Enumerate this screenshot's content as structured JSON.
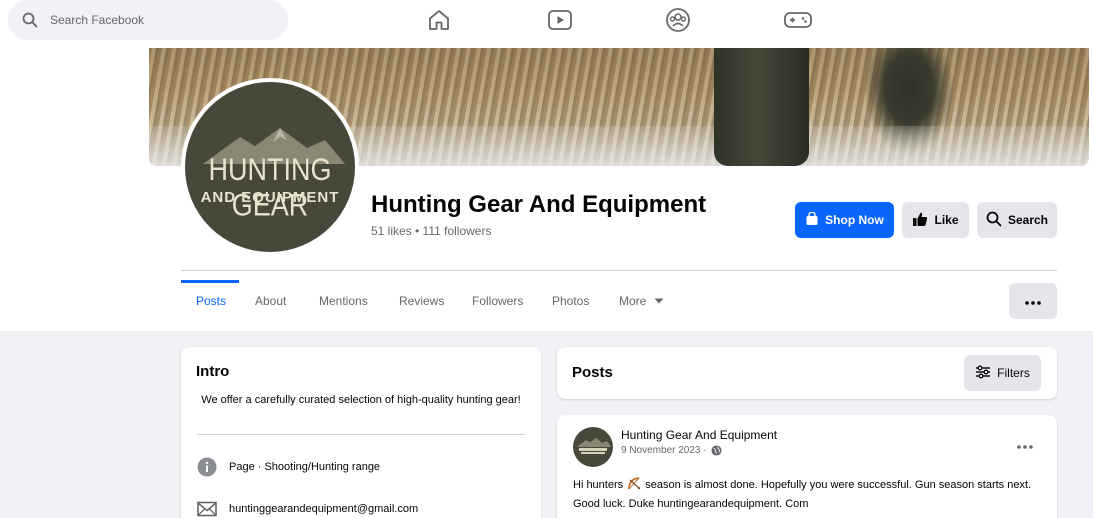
{
  "search": {
    "placeholder": "Search Facebook"
  },
  "nav": {
    "icons": [
      "home-icon",
      "video-icon",
      "groups-icon",
      "gaming-icon"
    ]
  },
  "page": {
    "name": "Hunting Gear And Equipment",
    "stats": "51 likes • 111 followers",
    "logo_line1": "HUNTING GEAR",
    "logo_line2": "AND EQUIPMENT"
  },
  "actions": {
    "shop_now": "Shop Now",
    "like": "Like",
    "search": "Search"
  },
  "tabs": [
    {
      "label": "Posts",
      "active": true
    },
    {
      "label": "About"
    },
    {
      "label": "Mentions"
    },
    {
      "label": "Reviews"
    },
    {
      "label": "Followers"
    },
    {
      "label": "Photos"
    },
    {
      "label": "More"
    }
  ],
  "intro": {
    "title": "Intro",
    "description": "We offer a carefully curated selection of high-quality hunting gear!",
    "category": "Page · Shooting/Hunting range",
    "email": "huntinggearandequipment@gmail.com"
  },
  "posts_section": {
    "title": "Posts",
    "filters_label": "Filters"
  },
  "post": {
    "author": "Hunting Gear And Equipment",
    "date": "9 November 2023 ·",
    "text_before_emoji": "Hi hunters ",
    "emoji": "bow-and-arrow",
    "text_after_emoji": " season is almost done. Hopefully you were successful. Gun season starts next. Good luck.  Duke  huntingearandequipment. Com"
  },
  "colors": {
    "accent": "#0866ff",
    "button_gray": "#e4e6eb",
    "page_bg": "#f0f2f5",
    "secondary_text": "#65676b",
    "logo_bg": "#48483a"
  }
}
